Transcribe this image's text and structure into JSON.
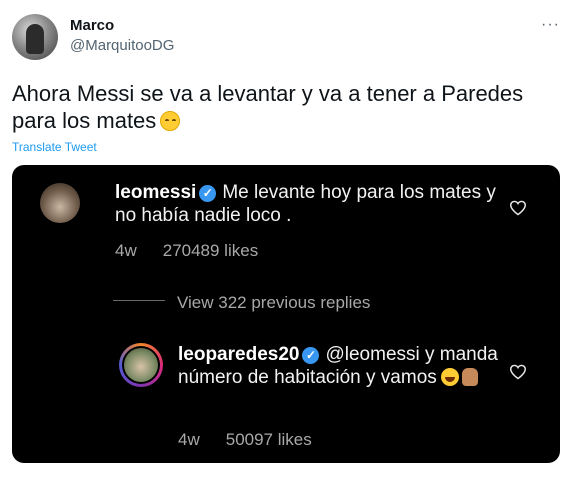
{
  "tweet": {
    "display_name": "Marco",
    "handle": "@MarquitooDG",
    "more_label": "···",
    "text": "Ahora Messi se va a levantar y va a tener a Paredes para los mates",
    "text_emoji": "relieved-face-emoji",
    "translate_label": "Translate Tweet"
  },
  "instagram": {
    "comment1": {
      "username": "leomessi",
      "verified_icon": "verified-badge-icon",
      "text": "Me levante hoy para los mates y no había nadie loco .",
      "time": "4w",
      "likes": "270489 likes"
    },
    "view_replies": "View 322 previous replies",
    "reply": {
      "username": "leoparedes20",
      "verified_icon": "verified-badge-icon",
      "text": "@leomessi y manda número de habitación y vamos",
      "emojis": [
        "face-with-tears-of-joy-emoji",
        "waving-hand-emoji"
      ],
      "time": "4w",
      "likes": "50097 likes"
    }
  },
  "colors": {
    "link": "#1d9bf0",
    "secondary_text": "#536471",
    "card_bg": "#000000",
    "verified": "#3897f0"
  }
}
